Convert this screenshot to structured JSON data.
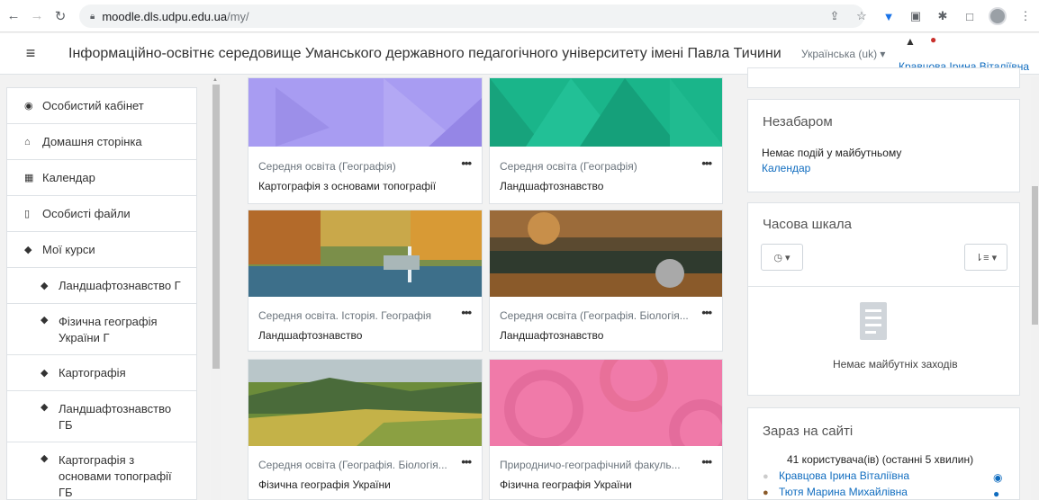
{
  "browser": {
    "url_host": "moodle.dls.udpu.edu.ua",
    "url_path": "/my/"
  },
  "header": {
    "site_name": "Інформаційно-освітнє середовище Уманського державного педагогічного університету імені Павла Тичини",
    "language": "Українська (uk) ▾",
    "user_name": "Кравцова Ірина Віталіївна"
  },
  "drawer": {
    "items": [
      {
        "label": "Особистий кабінет",
        "icon": "dashboard-icon"
      },
      {
        "label": "Домашня сторінка",
        "icon": "home-icon"
      },
      {
        "label": "Календар",
        "icon": "calendar-icon"
      },
      {
        "label": "Особисті файли",
        "icon": "file-icon"
      },
      {
        "label": "Мої курси",
        "icon": "graduation-cap-icon"
      },
      {
        "label": "Ландшафтознавство Г",
        "icon": "graduation-cap-icon"
      },
      {
        "label": "Фізична географія України Г",
        "icon": "graduation-cap-icon"
      },
      {
        "label": "Картографія",
        "icon": "graduation-cap-icon"
      },
      {
        "label": "Ландшафтознавство ГБ",
        "icon": "graduation-cap-icon"
      },
      {
        "label": "Картографія з основами топографії ГБ",
        "icon": "graduation-cap-icon"
      }
    ]
  },
  "courses": [
    {
      "category": "Середня освіта (Географія)",
      "name": "Картографія з основами топографії",
      "image": "purple-pattern"
    },
    {
      "category": "Середня освіта (Географія)",
      "name": "Ландшафтознавство",
      "image": "green-pattern"
    },
    {
      "category": "Середня освіта. Історія. Географія",
      "name": "Ландшафтознавство",
      "image": "autumn-park-photo"
    },
    {
      "category": "Середня освіта (Географія. Біологія...",
      "name": "Ландшафтознавство",
      "image": "stream-photo"
    },
    {
      "category": "Середня освіта (Географія. Біологія...",
      "name": "Фізична географія України",
      "image": "hills-photo"
    },
    {
      "category": "Природничо-географічний факуль...",
      "name": "Фізична географія України",
      "image": "pink-pattern"
    }
  ],
  "upcoming": {
    "title": "Незабаром",
    "empty_text": "Немає подій у майбутньому",
    "calendar_link": "Календар"
  },
  "timeline": {
    "title": "Часова шкала",
    "empty_text": "Немає майбутніх заходів"
  },
  "online": {
    "title": "Зараз на сайті",
    "summary": "41 користувача(ів) (останні 5 хвилин)",
    "users": [
      "Кравцова Ірина Віталіївна",
      "Тютя Марина Михайлівна"
    ]
  },
  "colors": {
    "accent": "#0f6cbf",
    "purple_card": "#a89cf2",
    "green_card": "#1ab58a",
    "pink_card": "#f07aa9"
  }
}
